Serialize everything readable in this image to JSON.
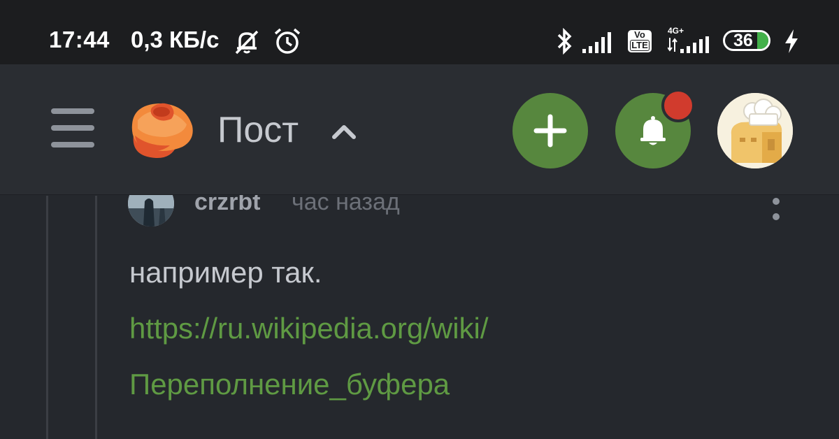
{
  "status_bar": {
    "time": "17:44",
    "network_speed": "0,3 КБ/с",
    "icons": [
      "notifications-muted-icon",
      "alarm-icon",
      "bluetooth-icon",
      "signal-icon",
      "volte-icon",
      "signal-4g-icon",
      "battery-icon",
      "charging-icon"
    ],
    "volte_label_top": "Vo",
    "volte_label_bottom": "LTE",
    "network_type": "4G+",
    "battery_level": "36",
    "battery_color": "#43b14a"
  },
  "header": {
    "title": "Пост",
    "icons": [
      "menu-icon",
      "pikabu-logo",
      "chevron-up-icon",
      "plus-icon",
      "bell-icon",
      "user-avatar"
    ],
    "accent_color": "#57873e",
    "notification_color": "#d13b2d"
  },
  "comment": {
    "author": "crzrbt",
    "time_ago": "час назад",
    "text": "например так.",
    "link_line1": "https://ru.wikipedia.org/wiki/",
    "link_line2": "Переполнение_буфера",
    "link_color": "#5f9a43"
  }
}
